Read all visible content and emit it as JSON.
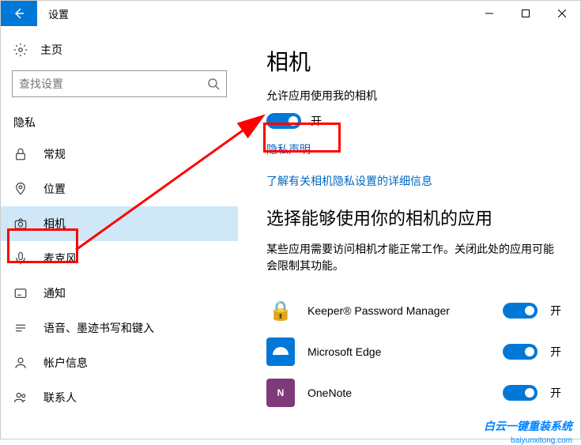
{
  "titlebar": {
    "title": "设置"
  },
  "sidebar": {
    "home": "主页",
    "search_placeholder": "查找设置",
    "section": "隐私",
    "items": [
      {
        "label": "常规"
      },
      {
        "label": "位置"
      },
      {
        "label": "相机"
      },
      {
        "label": "麦克风"
      },
      {
        "label": "通知"
      },
      {
        "label": "语音、墨迹书写和键入"
      },
      {
        "label": "帐户信息"
      },
      {
        "label": "联系人"
      }
    ]
  },
  "main": {
    "title": "相机",
    "allow_desc": "允许应用使用我的相机",
    "toggle_state": "开",
    "privacy_link": "隐私声明",
    "learn_link": "了解有关相机隐私设置的详细信息",
    "choose_title": "选择能够使用你的相机的应用",
    "choose_desc": "某些应用需要访问相机才能正常工作。关闭此处的应用可能会限制其功能。",
    "apps": [
      {
        "name": "Keeper® Password Manager",
        "state": "开"
      },
      {
        "name": "Microsoft Edge",
        "state": "开"
      },
      {
        "name": "OneNote",
        "state": "开"
      }
    ]
  },
  "watermark": {
    "main": "白云一键重装系统",
    "sub": "baiyunxitong.com"
  }
}
